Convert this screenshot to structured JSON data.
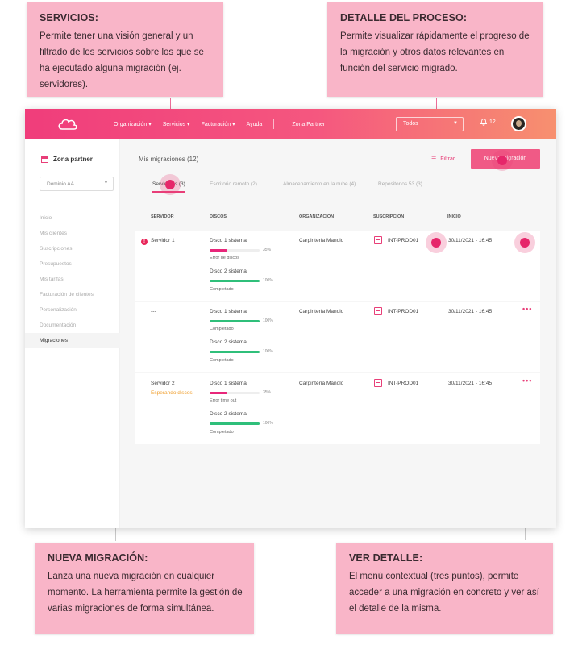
{
  "callouts": {
    "servicios": {
      "title": "SERVICIOS:",
      "text": "Permite tener una visión general y un filtrado de los servicios sobre los que se ha ejecutado alguna migración (ej. servidores)."
    },
    "detalle": {
      "title": "DETALLE DEL PROCESO:",
      "text": "Permite visualizar rápidamente el progreso de la migración y otros datos relevantes en función del servicio migrado."
    },
    "nueva": {
      "title": "NUEVA MIGRACIÓN:",
      "text": "Lanza una nueva migración en cualquier momento. La herramienta permite la gestión de varias migraciones de forma simultánea."
    },
    "ver": {
      "title": "VER DETALLE:",
      "text": "El menú contextual (tres puntos), permite acceder a una migración en concreto y ver así el detalle de la misma."
    }
  },
  "topbar": {
    "nav": [
      "Organización ▾",
      "Servicios ▾",
      "Facturación ▾",
      "Ayuda"
    ],
    "zona": "Zona Partner",
    "select": "Todos",
    "notifications": "12"
  },
  "sidebar": {
    "title": "Zona partner",
    "domain": "Dominio AA",
    "items": [
      "Inicio",
      "Mis clientes",
      "Suscripciones",
      "Presupuestos",
      "Mis tarifas",
      "Facturación de clientes",
      "Personalización",
      "Documentación",
      "Migraciones"
    ]
  },
  "main": {
    "title": "Mis migraciones (12)",
    "filter": "Filtrar",
    "new_button": "Nueva migración",
    "tabs": [
      "Servidores (3)",
      "Escritorio remoto (2)",
      "Almacenamiento en la nube (4)",
      "Repositorios 53 (3)"
    ],
    "headers": [
      "SERVIDOR",
      "DISCOS",
      "ORGANIZACIÓN",
      "SUSCRIPCIÓN",
      "INICIO"
    ],
    "rows": [
      {
        "server": "Servidor 1",
        "status": "",
        "disks": [
          {
            "name": "Disco 1 sistema",
            "pct": "35%",
            "state": "Error de discos",
            "value": 0.35,
            "color": "#e8267a"
          },
          {
            "name": "Disco 2 sistema",
            "pct": "100%",
            "state": "Completado",
            "value": 1.0,
            "color": "#2fbf7a"
          }
        ],
        "org": "Carpintería Manolo",
        "sub": "INT-PROD01",
        "date": "30/11/2021 - 16:45"
      },
      {
        "server": "---",
        "status": "",
        "disks": [
          {
            "name": "Disco 1 sistema",
            "pct": "100%",
            "state": "Completado",
            "value": 1.0,
            "color": "#2fbf7a"
          },
          {
            "name": "Disco 2 sistema",
            "pct": "100%",
            "state": "Completado",
            "value": 1.0,
            "color": "#2fbf7a"
          }
        ],
        "org": "Carpintería Manolo",
        "sub": "INT-PROD01",
        "date": "30/11/2021 - 16:45"
      },
      {
        "server": "Servidor 2",
        "status": "Esperando discos",
        "disks": [
          {
            "name": "Disco 1 sistema",
            "pct": "35%",
            "state": "Error time out",
            "value": 0.35,
            "color": "#e8267a"
          },
          {
            "name": "Disco 2 sistema",
            "pct": "100%",
            "state": "Completado",
            "value": 1.0,
            "color": "#2fbf7a"
          }
        ],
        "org": "Carpintería Manolo",
        "sub": "INT-PROD01",
        "date": "30/11/2021 - 16:45"
      }
    ]
  },
  "accent": "#e83e78"
}
